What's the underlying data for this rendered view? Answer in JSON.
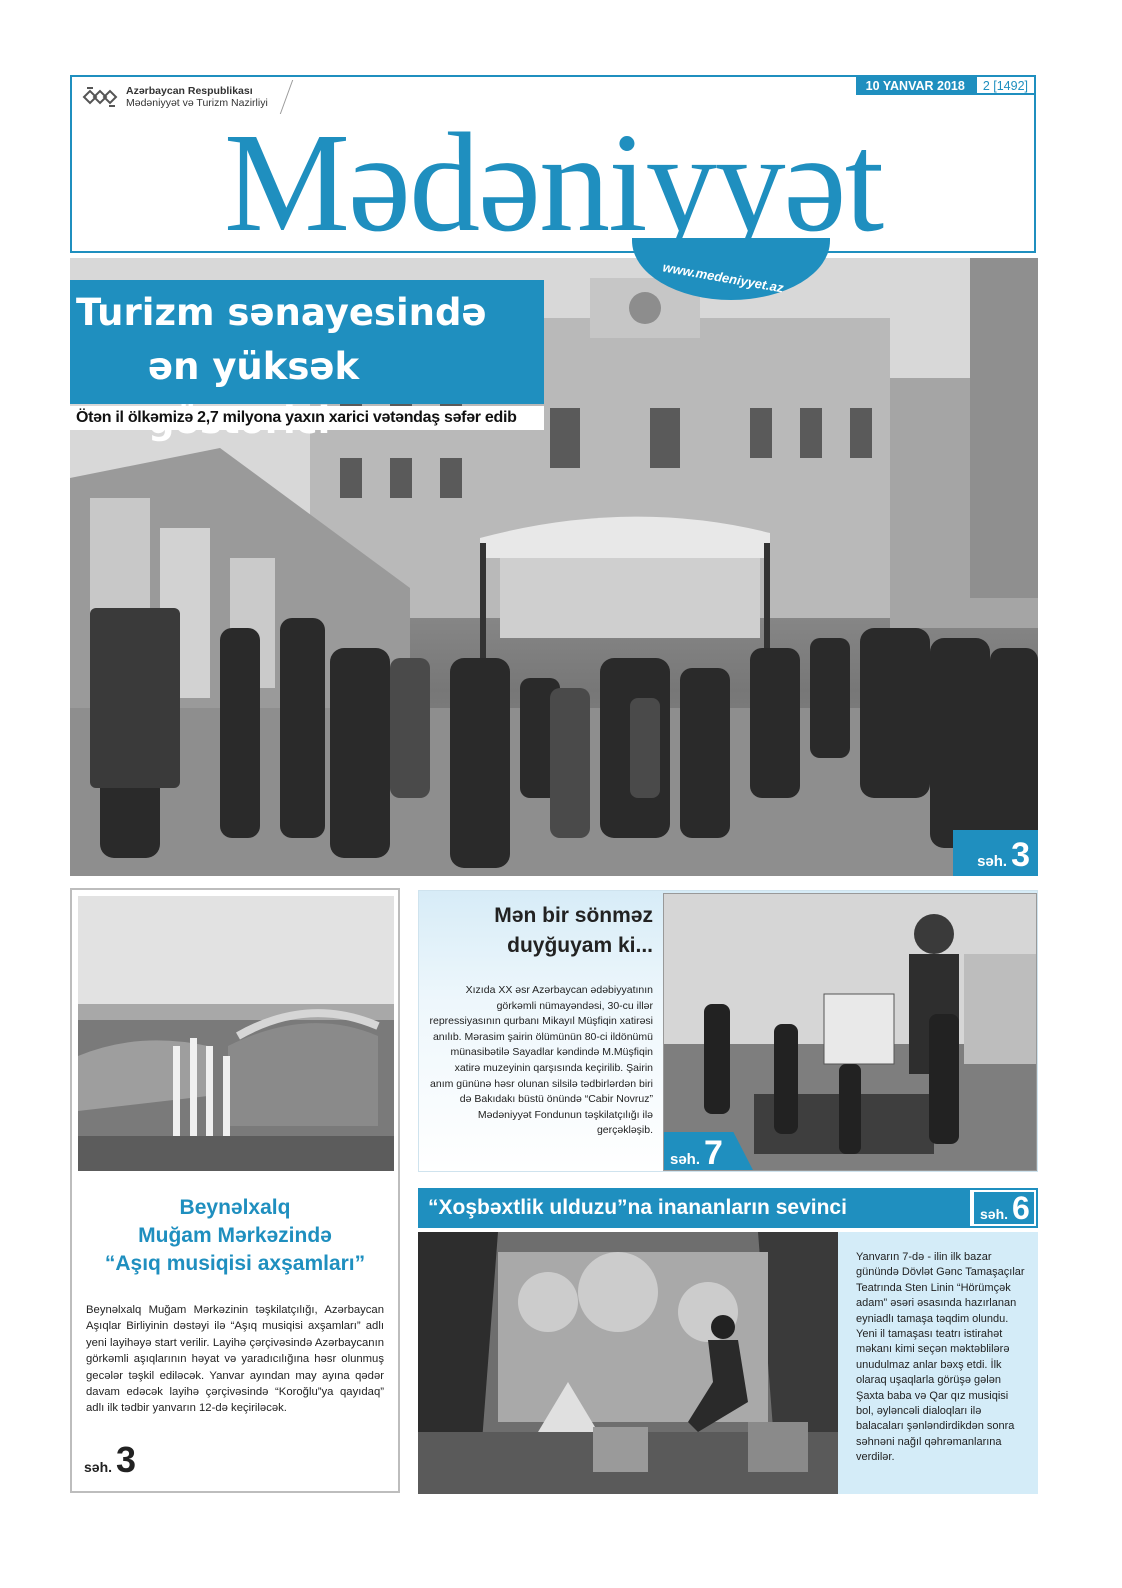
{
  "masthead": {
    "ministry_line1": "Azərbaycan Respublikası",
    "ministry_line2": "Mədəniyyət və Turizm Nazirliyi",
    "date": "10 YANVAR 2018",
    "issue": "2 [1492]",
    "logo": "Mədəniyyət",
    "website": "www.medeniyyet.az"
  },
  "lead": {
    "title_line1": "Turizm sənayesində",
    "title_line2": "ən yüksək göstərici",
    "subtitle": "Ötən il ölkəmizə 2,7 milyona yaxın xarici vətəndaş səfər edib",
    "page_label": "səh.",
    "page_num": "3"
  },
  "left_article": {
    "title_line1": "Beynəlxalq",
    "title_line2": "Muğam Mərkəzində",
    "title_line3": "“Aşıq musiqisi axşamları”",
    "body": "Beynəlxalq Muğam Mərkəzinin təşkilatçılığı, Azərbaycan Aşıqlar Birliyinin dəstəyi ilə “Aşıq musiqisi axşamları” adlı yeni layihəyə start verilir. Layihə çərçivəsində Azərbaycanın görkəmli aşıqlarının həyat və yaradıcılığına həsr olunmuş gecələr təşkil ediləcək. Yanvar ayından may ayına qədər davam edəcək layihə çərçivəsində “Koroğlu”ya qayıdaq” adlı ilk tədbir yanvarın 12-də keçiriləcək.",
    "page_label": "səh.",
    "page_num": "3"
  },
  "right_top": {
    "title_line1": "Mən bir sönməz",
    "title_line2": "duyğuyam ki...",
    "body": "Xızıda XX əsr Azərbaycan ədəbiyyatının görkəmli nümayəndəsi, 30-cu illər repressiyasının qurbanı Mikayıl Müşfiqin xatirəsi anılıb. Mərasim şairin ölümünün 80-ci ildönümü münasibətilə Sayadlar kəndində M.Müşfiqin xatirə muzeyinin qarşısında keçirilib. Şairin anım gününə həsr olunan silsilə tədbirlərdən biri də Bakıdakı büstü önündə “Cabir Novruz” Mədəniyyət Fondunun təşkilatçılığı ilə gerçəkləşib.",
    "page_label": "səh.",
    "page_num": "7"
  },
  "right_bottom": {
    "headline": "“Xoşbəxtlik ulduzu”na inananların sevinci",
    "page_label": "səh.",
    "page_num": "6",
    "body": "Yanvarın 7-də - ilin ilk bazar günündə Dövlət Gənc Tamaşaçılar Teatrında Sten Linin “Hörümçək adam” əsəri əsasında hazırlanan eyniadlı tamaşa təqdim olundu. Yeni il tamaşası teatrı istirahət məkanı kimi seçən məktəblilərə unudulmaz anlar bəxş etdi. İlk olaraq uşaqlarla görüşə gələn Şaxta baba və Qar qız musiqisi bol, əyləncəli dialoqları ilə balacaları şənləndirdikdən sonra səhnəni nağıl qəhrəmanlarına verdilər."
  },
  "colors": {
    "brand": "#1f8fbf",
    "light_blue": "#d4ecf8"
  }
}
